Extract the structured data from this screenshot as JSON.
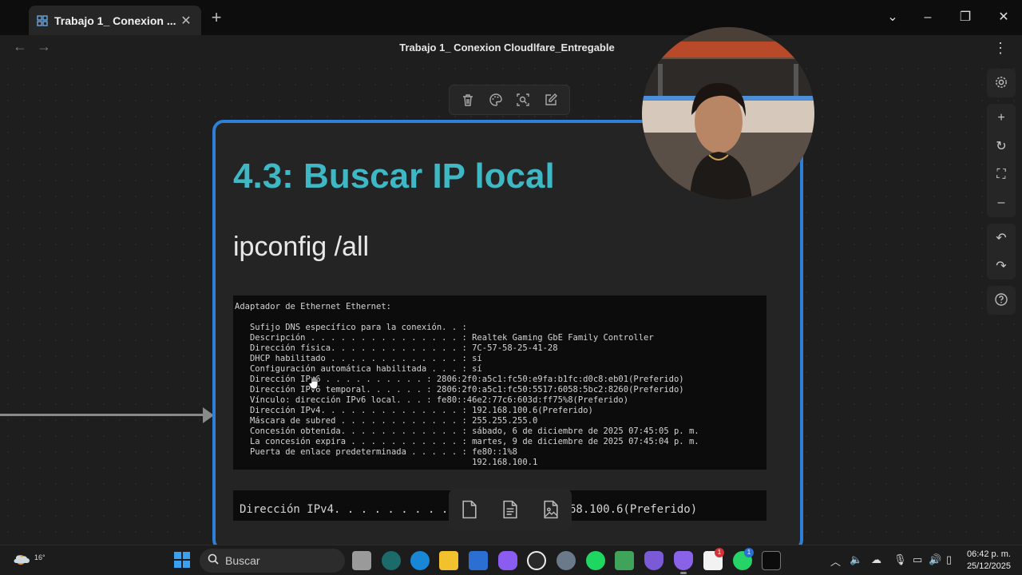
{
  "window": {
    "tab_title": "Trabajo 1_ Conexion ...",
    "doc_title": "Trabajo 1_ Conexion Cloudlfare_Entregable"
  },
  "card": {
    "heading": "4.3: Buscar IP local",
    "subheading": "ipconfig /all",
    "terminal_lines": [
      "Adaptador de Ethernet Ethernet:",
      "",
      "   Sufijo DNS específico para la conexión. . :",
      "   Descripción . . . . . . . . . . . . . . . : Realtek Gaming GbE Family Controller",
      "   Dirección física. . . . . . . . . . . . . : 7C-57-58-25-41-28",
      "   DHCP habilitado . . . . . . . . . . . . . : sí",
      "   Configuración automática habilitada . . . : sí",
      "   Dirección IPv6 . . . . . . . . . . : 2806:2f0:a5c1:fc50:e9fa:b1fc:d0c8:eb01(Preferido)",
      "   Dirección IPv6 temporal. . . . . . : 2806:2f0:a5c1:fc50:5517:6058:5bc2:8260(Preferido)",
      "   Vínculo: dirección IPv6 local. . . : fe80::46e2:77c6:603d:ff75%8(Preferido)",
      "   Dirección IPv4. . . . . . . . . . . . . . : 192.168.100.6(Preferido)",
      "   Máscara de subred . . . . . . . . . . . . : 255.255.255.0",
      "   Concesión obtenida. . . . . . . . . . . . : sábado, 6 de diciembre de 2025 07:45:05 p. m.",
      "   La concesión expira . . . . . . . . . . . : martes, 9 de diciembre de 2025 07:45:04 p. m.",
      "   Puerta de enlace predeterminada . . . . . : fe80::1%8",
      "                                               192.168.100.1"
    ],
    "zoom_line": "Dirección IPv4. . . . . . . . . . . . . . : 192.168.100.6(Preferido)"
  },
  "taskbar": {
    "weather_temp": "16°",
    "search_placeholder": "Buscar",
    "time": "06:42 p. m.",
    "date": "25/12/2025",
    "badges": {
      "notion": "1",
      "whatsapp": "1"
    }
  },
  "colors": {
    "accent_border": "#2f7fd6",
    "heading": "#3db8c4"
  }
}
